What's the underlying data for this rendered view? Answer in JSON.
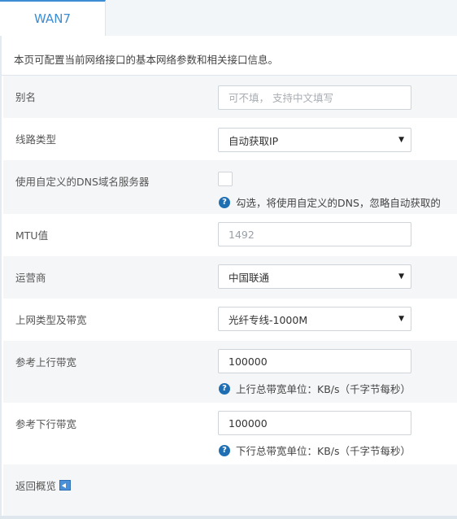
{
  "tab": {
    "label": "WAN7"
  },
  "description": "本页可配置当前网络接口的基本网络参数和相关接口信息。",
  "fields": {
    "alias": {
      "label": "别名",
      "placeholder": "可不填， 支持中文填写"
    },
    "line_type": {
      "label": "线路类型",
      "value": "自动获取IP"
    },
    "custom_dns": {
      "label": "使用自定义的DNS域名服务器",
      "hint": "勾选，将使用自定义的DNS，忽略自动获取的"
    },
    "mtu": {
      "label": "MTU值",
      "value": "1492"
    },
    "isp": {
      "label": "运营商",
      "value": "中国联通"
    },
    "net_type": {
      "label": "上网类型及带宽",
      "value": "光纤专线-1000M"
    },
    "upload": {
      "label": "参考上行带宽",
      "value": "100000",
      "hint": "上行总带宽单位：KB/s（千字节每秒）"
    },
    "download": {
      "label": "参考下行带宽",
      "value": "100000",
      "hint": "下行总带宽单位：KB/s（千字节每秒）"
    }
  },
  "back": {
    "label": "返回概览"
  },
  "colors": {
    "accent": "#3c8dd4",
    "help_icon": "#1f6fb2",
    "row_alt": "#f5f6f8"
  }
}
